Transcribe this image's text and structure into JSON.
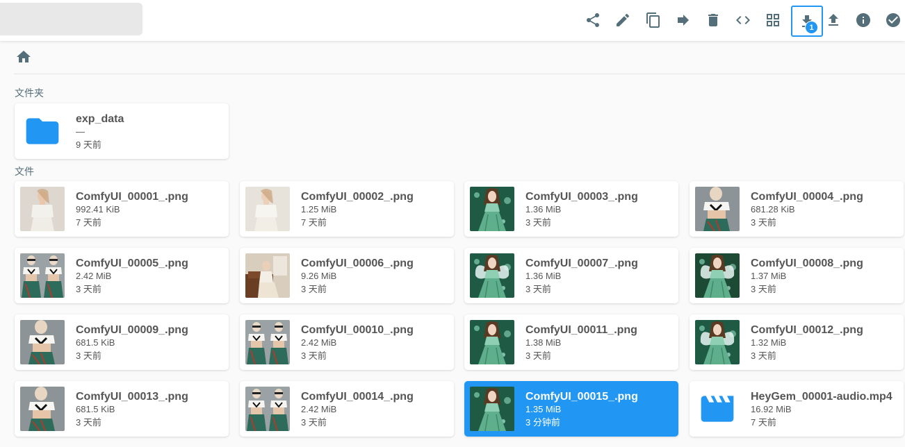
{
  "toolbar": {
    "upload_badge_count": "1",
    "icons": [
      "share-icon",
      "edit-icon",
      "copy-icon",
      "move-icon",
      "delete-icon",
      "embed-code-icon",
      "grid-view-icon",
      "download-icon",
      "upload-icon",
      "info-icon",
      "select-all-icon"
    ]
  },
  "sections": {
    "folders_title": "文件夹",
    "files_title": "文件"
  },
  "folders": [
    {
      "name": "exp_data",
      "size": "—",
      "modified": "9 天前"
    }
  ],
  "files": [
    {
      "name": "ComfyUI_00001_.png",
      "size": "992.41 KiB",
      "modified": "7 天前",
      "thumb": "white-top"
    },
    {
      "name": "ComfyUI_00002_.png",
      "size": "1.25 MiB",
      "modified": "7 天前",
      "thumb": "white-dress"
    },
    {
      "name": "ComfyUI_00003_.png",
      "size": "1.36 MiB",
      "modified": "3 天前",
      "thumb": "fairy"
    },
    {
      "name": "ComfyUI_00004_.png",
      "size": "681.28 KiB",
      "modified": "3 天前",
      "thumb": "crop-top"
    },
    {
      "name": "ComfyUI_00005_.png",
      "size": "2.42 MiB",
      "modified": "3 天前",
      "thumb": "double"
    },
    {
      "name": "ComfyUI_00006_.png",
      "size": "9.26 MiB",
      "modified": "3 天前",
      "thumb": "room"
    },
    {
      "name": "ComfyUI_00007_.png",
      "size": "1.36 MiB",
      "modified": "3 天前",
      "thumb": "fairy-wing"
    },
    {
      "name": "ComfyUI_00008_.png",
      "size": "1.37 MiB",
      "modified": "3 天前",
      "thumb": "fairy-forest"
    },
    {
      "name": "ComfyUI_00009_.png",
      "size": "681.5 KiB",
      "modified": "3 天前",
      "thumb": "crop-top"
    },
    {
      "name": "ComfyUI_00010_.png",
      "size": "2.42 MiB",
      "modified": "3 天前",
      "thumb": "double"
    },
    {
      "name": "ComfyUI_00011_.png",
      "size": "1.38 MiB",
      "modified": "3 天前",
      "thumb": "fairy"
    },
    {
      "name": "ComfyUI_00012_.png",
      "size": "1.32 MiB",
      "modified": "3 天前",
      "thumb": "fairy-wing"
    },
    {
      "name": "ComfyUI_00013_.png",
      "size": "681.5 KiB",
      "modified": "3 天前",
      "thumb": "crop-top"
    },
    {
      "name": "ComfyUI_00014_.png",
      "size": "2.42 MiB",
      "modified": "3 天前",
      "thumb": "double"
    },
    {
      "name": "ComfyUI_00015_.png",
      "size": "1.35 MiB",
      "modified": "3 分钟前",
      "thumb": "fairy",
      "selected": true
    },
    {
      "name": "HeyGem_00001-audio.mp4",
      "size": "16.92 MiB",
      "modified": "7 天前",
      "thumb": "video-icon"
    }
  ],
  "colors": {
    "accent": "#2196f3",
    "icon": "#546e7a"
  }
}
